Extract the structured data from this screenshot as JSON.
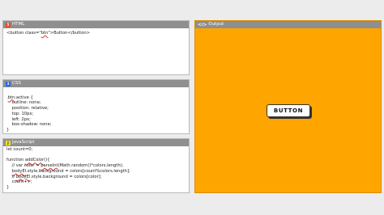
{
  "panels": {
    "html": {
      "title": "HTML",
      "icon": "html5-icon",
      "icon_glyph": "5"
    },
    "css": {
      "title": "CSS",
      "icon": "css3-icon",
      "icon_glyph": "3"
    },
    "js": {
      "title": "JavaScript",
      "icon": "js-icon",
      "icon_glyph": "J"
    },
    "output": {
      "title": "Output",
      "icon": "code-brackets-icon",
      "icon_glyph": "</>"
    }
  },
  "code": {
    "html": [
      {
        "parts": [
          {
            "t": "<button class=\""
          },
          {
            "t": "btn",
            "ul": true
          },
          {
            "t": "\">Button</button>"
          }
        ]
      }
    ],
    "css": [
      {
        "parts": [
          {
            "t": ""
          }
        ]
      },
      {
        "parts": [
          {
            "t": "."
          },
          {
            "t": "btn",
            "ul": true
          },
          {
            "t": ":active {"
          }
        ]
      },
      {
        "parts": [
          {
            "t": "    outline: none;"
          }
        ]
      },
      {
        "parts": [
          {
            "t": "    position: relative;"
          }
        ]
      },
      {
        "parts": [
          {
            "t": "    top: 10px;"
          }
        ]
      },
      {
        "parts": [
          {
            "t": "    left: 2px;"
          }
        ]
      },
      {
        "parts": [
          {
            "t": "    box-shadow: none;"
          }
        ]
      },
      {
        "parts": [
          {
            "t": "}"
          }
        ]
      }
    ],
    "js": [
      {
        "parts": [
          {
            "t": "let count=0;"
          }
        ]
      },
      {
        "parts": [
          {
            "t": ""
          }
        ]
      },
      {
        "parts": [
          {
            "t": "function "
          },
          {
            "t": "addColor",
            "ul": true
          },
          {
            "t": "(){"
          }
        ]
      },
      {
        "parts": [
          {
            "t": "    // var color = "
          },
          {
            "t": "parseInt",
            "ul": true
          },
          {
            "t": "(Math.random()*colors.length);"
          }
        ]
      },
      {
        "parts": [
          {
            "t": "    "
          },
          {
            "t": "bodyEl",
            "ul": true
          },
          {
            "t": ".style.background = colors[count%colors.length];"
          }
        ]
      },
      {
        "parts": [
          {
            "t": "    // "
          },
          {
            "t": "bodyEl",
            "ul": true
          },
          {
            "t": ".style.background = colors[color];"
          }
        ]
      },
      {
        "parts": [
          {
            "t": "    count++;"
          }
        ]
      },
      {
        "parts": [
          {
            "t": "}"
          }
        ]
      }
    ]
  },
  "output": {
    "background": "#ffa500",
    "button_label": "BUTTON"
  }
}
